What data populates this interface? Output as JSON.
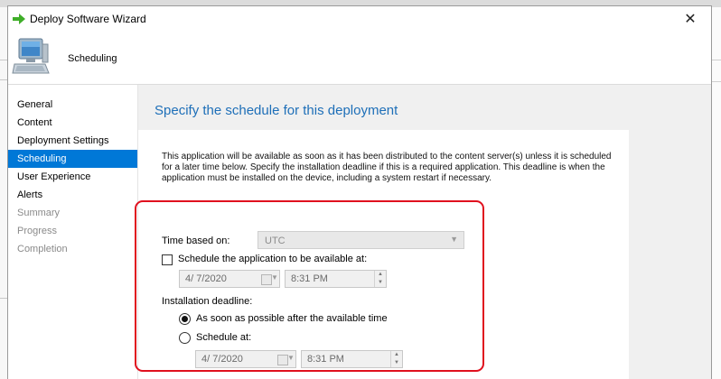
{
  "window": {
    "title": "Deploy Software Wizard",
    "close_glyph": "✕"
  },
  "header": {
    "title": "Scheduling",
    "icon": "computer-icon"
  },
  "nav": {
    "items": [
      {
        "label": "General"
      },
      {
        "label": "Content"
      },
      {
        "label": "Deployment Settings"
      },
      {
        "label": "Scheduling"
      },
      {
        "label": "User Experience"
      },
      {
        "label": "Alerts"
      },
      {
        "label": "Summary"
      },
      {
        "label": "Progress"
      },
      {
        "label": "Completion"
      }
    ],
    "active_index": 3,
    "disabled_from_index": 6
  },
  "content": {
    "title": "Specify the schedule for this deployment",
    "description": "This application will be available as soon as it has been distributed to the content server(s) unless it is scheduled for a later time below. Specify the installation deadline if this is a required application. This deadline is when the application must be installed on the device, including a system restart if necessary."
  },
  "form": {
    "time_based_on": {
      "label": "Time based on:",
      "value": "UTC"
    },
    "schedule_available": {
      "label": "Schedule the application to be available at:",
      "checked": false,
      "date": "4/  7/2020",
      "time": "8:31 PM"
    },
    "deadline": {
      "label": "Installation deadline:",
      "asap_label": "As soon as possible after the available time",
      "schedule_label": "Schedule at:",
      "selected": "asap",
      "date": "4/  7/2020",
      "time": "8:31 PM"
    }
  },
  "colors": {
    "accent": "#0078d7",
    "title_blue": "#1e6fb8",
    "highlight_red": "#e0101e"
  }
}
